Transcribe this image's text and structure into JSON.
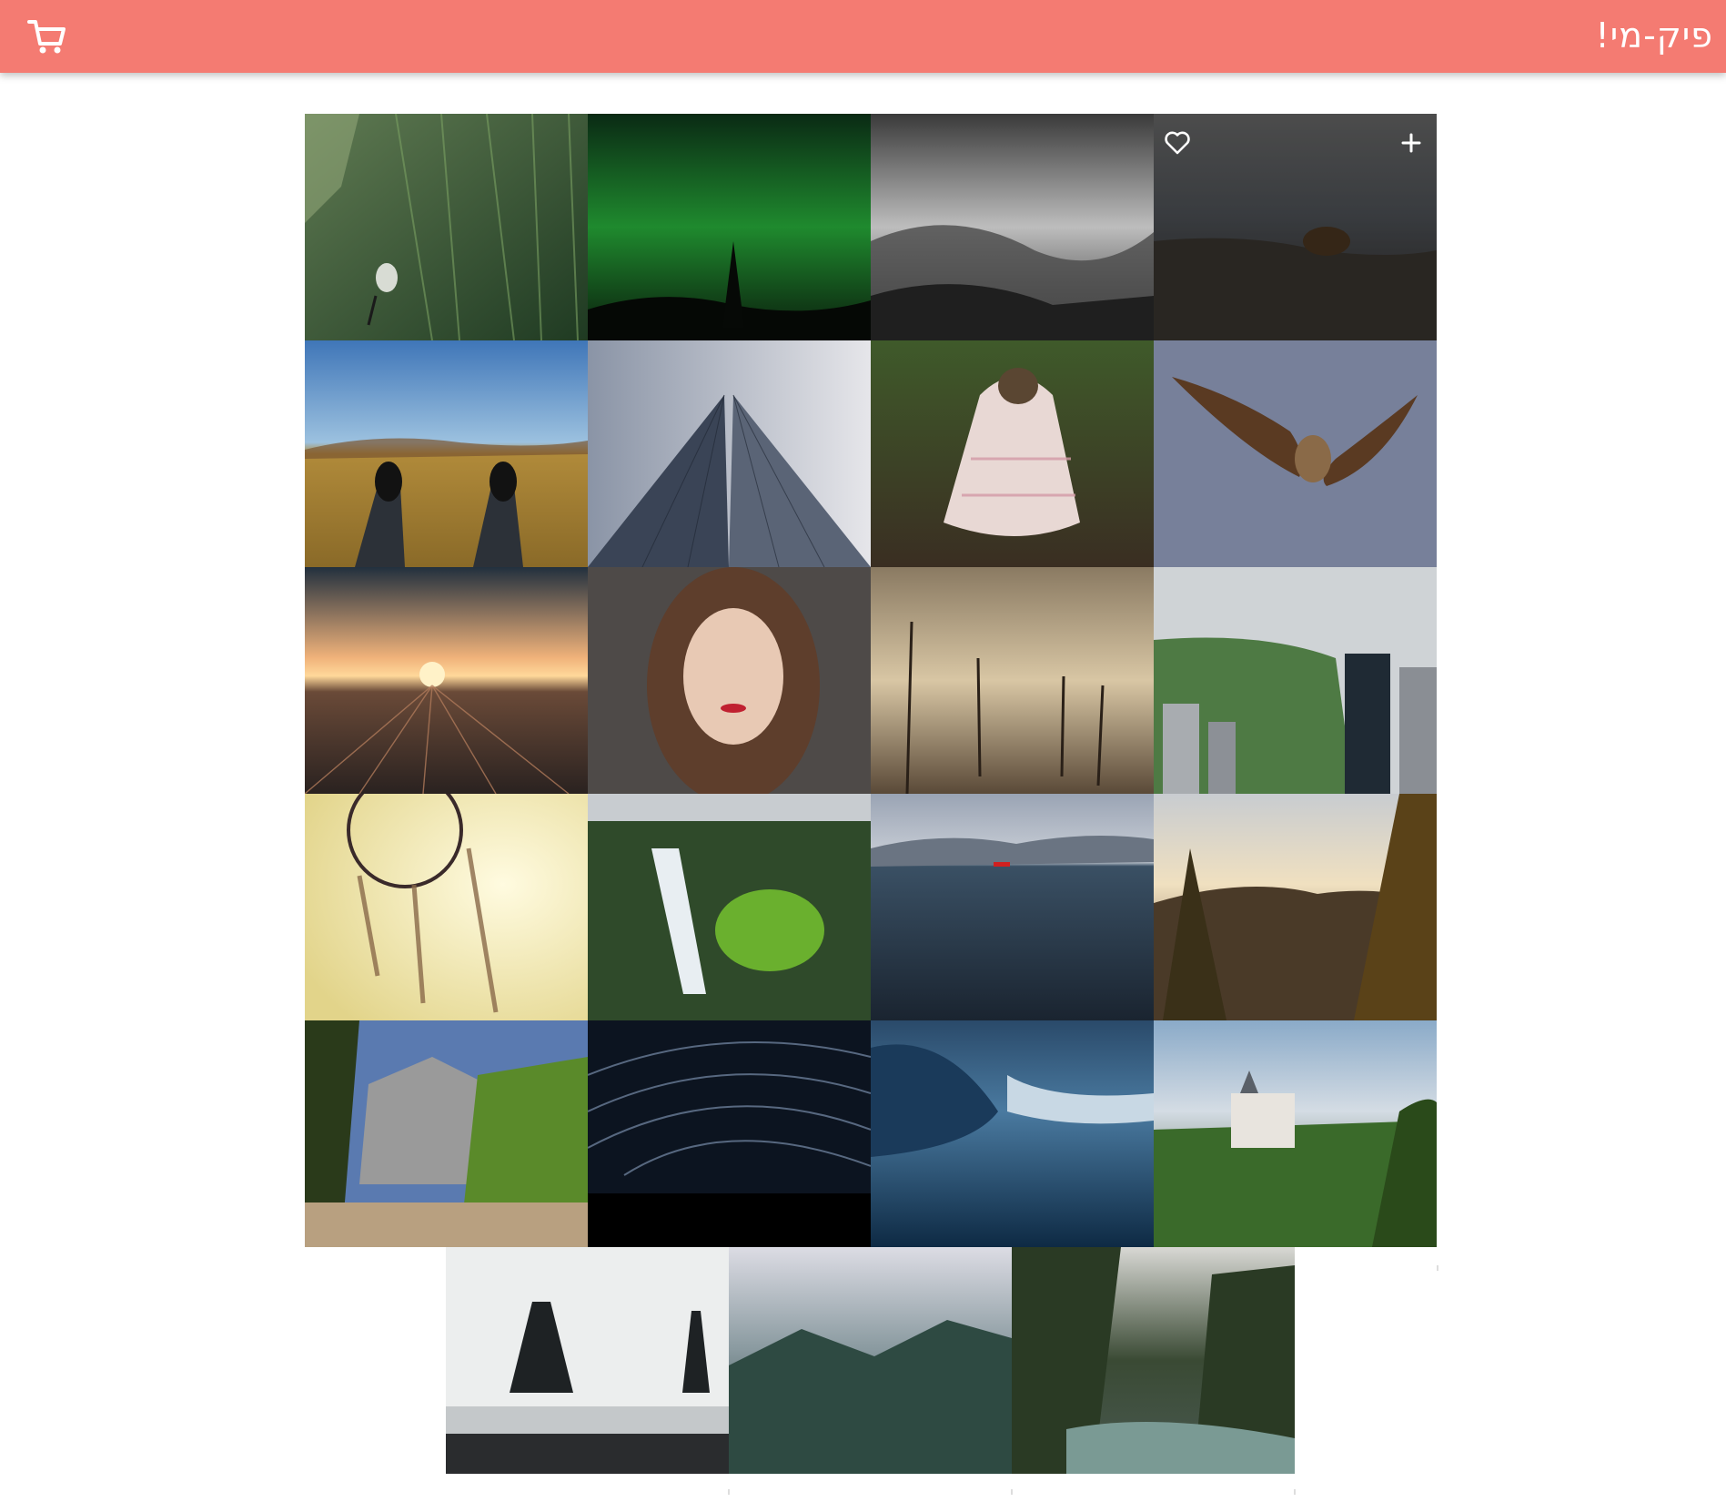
{
  "header": {
    "brand": "פיק-מי!",
    "cart_icon": "shopping-cart-icon",
    "color": "#f47b72"
  },
  "gallery": {
    "hover_actions": {
      "favorite_icon": "heart-outline-icon",
      "add_icon": "plus-icon"
    },
    "photos": [
      {
        "name": "photo-cyclist-forest"
      },
      {
        "name": "photo-aurora-green"
      },
      {
        "name": "photo-misty-forest-bw"
      },
      {
        "name": "photo-bear-hill",
        "hovered": true
      },
      {
        "name": "photo-sneakers-field"
      },
      {
        "name": "photo-skyscraper"
      },
      {
        "name": "photo-pug-blanket"
      },
      {
        "name": "photo-vulture-flight"
      },
      {
        "name": "photo-railyard-sunset"
      },
      {
        "name": "photo-woman-portrait"
      },
      {
        "name": "photo-dead-trees-fog"
      },
      {
        "name": "photo-central-park"
      },
      {
        "name": "photo-dreamcatcher"
      },
      {
        "name": "photo-waterfall"
      },
      {
        "name": "photo-sea-boat"
      },
      {
        "name": "photo-yosemite-sunset"
      },
      {
        "name": "photo-yosemite-valley"
      },
      {
        "name": "photo-star-trails"
      },
      {
        "name": "photo-wave-blue"
      },
      {
        "name": "photo-neuschwanstein"
      },
      {
        "name": "photo-sea-stacks"
      },
      {
        "name": "photo-foggy-mountain"
      },
      {
        "name": "photo-river-forest"
      }
    ]
  }
}
